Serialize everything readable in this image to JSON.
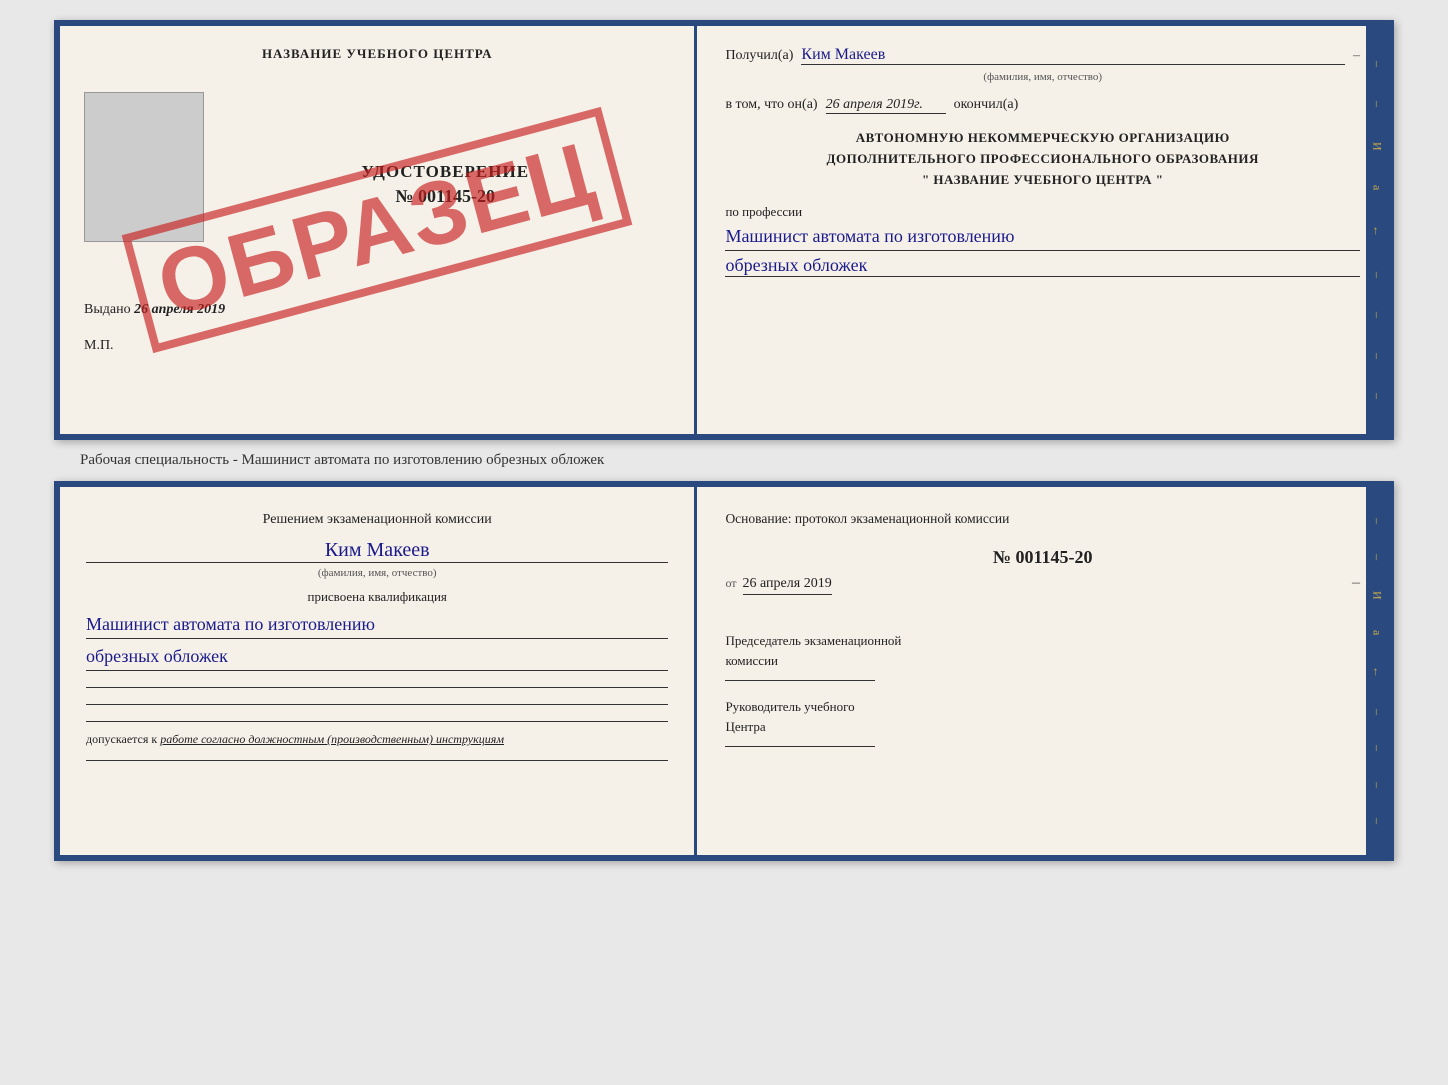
{
  "top_cert": {
    "left": {
      "title": "НАЗВАНИЕ УЧЕБНОГО ЦЕНТРА",
      "stamp": "ОБРАЗЕЦ",
      "udostoverenie_label": "УДОСТОВЕРЕНИЕ",
      "number": "№ 001145-20",
      "vydano_label": "Выдано",
      "vydano_date": "26 апреля 2019",
      "mp": "М.П."
    },
    "right": {
      "poluchil_label": "Получил(а)",
      "poluchil_value": "Ким Макеев",
      "poluchil_sublabel": "(фамилия, имя, отчество)",
      "vtom_label": "в том, что он(а)",
      "vtom_date": "26 апреля 2019г.",
      "okonchil_label": "окончил(а)",
      "org_line1": "АВТОНОМНУЮ НЕКОММЕРЧЕСКУЮ ОРГАНИЗАЦИЮ",
      "org_line2": "ДОПОЛНИТЕЛЬНОГО ПРОФЕССИОНАЛЬНОГО ОБРАЗОВАНИЯ",
      "org_line3": "\"  НАЗВАНИЕ УЧЕБНОГО ЦЕНТРА  \"",
      "professiya_label": "по профессии",
      "professiya_value1": "Машинист автомата по изготовлению",
      "professiya_value2": "обрезных обложек"
    }
  },
  "separator": {
    "text": "Рабочая специальность - Машинист автомата по изготовлению обрезных обложек"
  },
  "bottom_cert": {
    "left": {
      "title_line1": "Решением экзаменационной комиссии",
      "name": "Ким Макеев",
      "name_sublabel": "(фамилия, имя, отчество)",
      "assigned_label": "присвоена квалификация",
      "qual_value1": "Машинист автомата по изготовлению",
      "qual_value2": "обрезных обложек",
      "dopusk_label": "допускается к",
      "dopusk_value": "работе согласно должностным (производственным) инструкциям"
    },
    "right": {
      "osnovanie_label": "Основание: протокол экзаменационной комиссии",
      "protocol_num": "№ 001145-20",
      "ot_label": "от",
      "protocol_date": "26 апреля 2019",
      "predsedatel_label": "Председатель экзаменационной",
      "predsedatel_label2": "комиссии",
      "rukovoditel_label": "Руководитель учебного",
      "rukovoditel_label2": "Центра"
    }
  }
}
